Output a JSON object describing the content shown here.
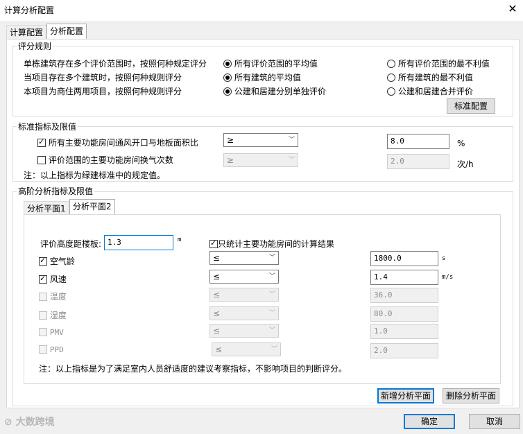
{
  "window": {
    "title": "计算分析配置",
    "close_glyph": "✕"
  },
  "tabs": [
    "计算配置",
    "分析配置"
  ],
  "scoring": {
    "title": "评分规则",
    "rows": [
      {
        "label": "单栋建筑存在多个评价范围时，按照何种规定评分",
        "opt1": "所有评价范围的平均值",
        "opt2": "所有评价范围的最不利值"
      },
      {
        "label": "当项目存在多个建筑时，按照何种规则评分",
        "opt1": "所有建筑的平均值",
        "opt2": "所有建筑的最不利值"
      },
      {
        "label": "本项目为商住两用项目，按照何种规则评分",
        "opt1": "公建和居建分别单独评价",
        "opt2": "公建和居建合并评价"
      }
    ],
    "std_button": "标准配置"
  },
  "standards": {
    "title": "标准指标及限值",
    "rows": [
      {
        "label": "所有主要功能房间通风开口与地板面积比",
        "op": "≥",
        "value": "8.0",
        "unit": "%"
      },
      {
        "label": "评价范围的主要功能房间换气次数",
        "op": "≥",
        "value": "2.0",
        "unit": "次/h"
      }
    ],
    "note": "注：以上指标为绿建标准中的规定值。"
  },
  "advanced": {
    "title": "高阶分析指标及限值",
    "tabs": [
      "分析平面1",
      "分析平面2"
    ],
    "height_label": "评价高度距楼板:",
    "height_value": "1.3",
    "height_unit": "m",
    "main_rooms_label": "只统计主要功能房间的计算结果",
    "rows": [
      {
        "label": "空气龄",
        "op": "≤",
        "value": "1800.0",
        "unit": "s"
      },
      {
        "label": "风速",
        "op": "≤",
        "value": "1.4",
        "unit": "m/s"
      },
      {
        "label": "温度",
        "op": "≤",
        "value": "36.0",
        "unit": ""
      },
      {
        "label": "湿度",
        "op": "≤",
        "value": "80.0",
        "unit": ""
      },
      {
        "label": "PMV",
        "op": "≤",
        "value": "1.0",
        "unit": ""
      },
      {
        "label": "PPD",
        "op": "≤",
        "value": "2.0",
        "unit": ""
      }
    ],
    "note": "注：以上指标是为了满足室内人员舒适度的建议考察指标，不影响项目的判断评分。",
    "add_button": "新增分析平面",
    "delete_button": "删除分析平面"
  },
  "footer": {
    "ok": "确定",
    "cancel": "取消"
  },
  "watermark": "大数跨境"
}
